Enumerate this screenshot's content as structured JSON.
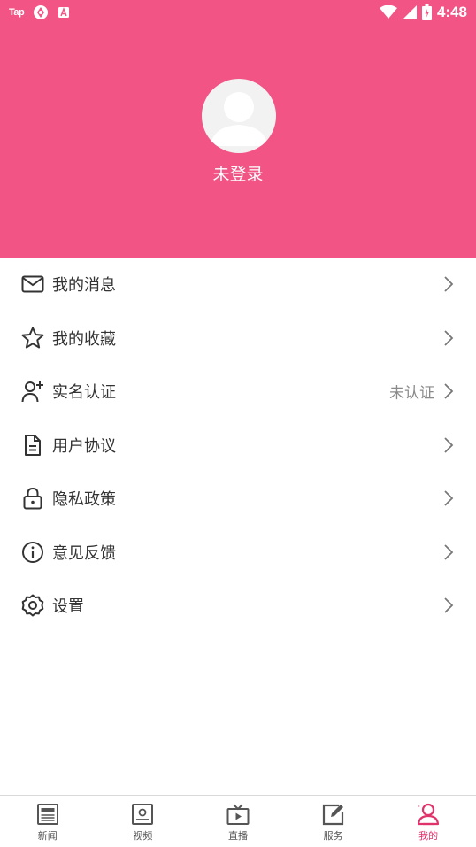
{
  "status_bar": {
    "app_label": "Tap",
    "time": "4:48"
  },
  "profile": {
    "login_text": "未登录"
  },
  "menu": [
    {
      "label": "我的消息",
      "icon": "mail-icon"
    },
    {
      "label": "我的收藏",
      "icon": "star-icon"
    },
    {
      "label": "实名认证",
      "icon": "user-add-icon",
      "extra": "未认证"
    },
    {
      "label": "用户协议",
      "icon": "document-icon"
    },
    {
      "label": "隐私政策",
      "icon": "lock-icon"
    },
    {
      "label": "意见反馈",
      "icon": "info-icon"
    },
    {
      "label": "设置",
      "icon": "gear-icon"
    }
  ],
  "tabs": [
    {
      "label": "新闻",
      "icon": "news-icon"
    },
    {
      "label": "视频",
      "icon": "video-icon"
    },
    {
      "label": "直播",
      "icon": "tv-icon"
    },
    {
      "label": "服务",
      "icon": "edit-icon"
    },
    {
      "label": "我的",
      "icon": "profile-icon",
      "active": true
    }
  ],
  "colors": {
    "header_bg": "#f15485",
    "active_tab": "#e0336b",
    "text_primary": "#333333",
    "text_secondary": "#8a8a8a"
  }
}
